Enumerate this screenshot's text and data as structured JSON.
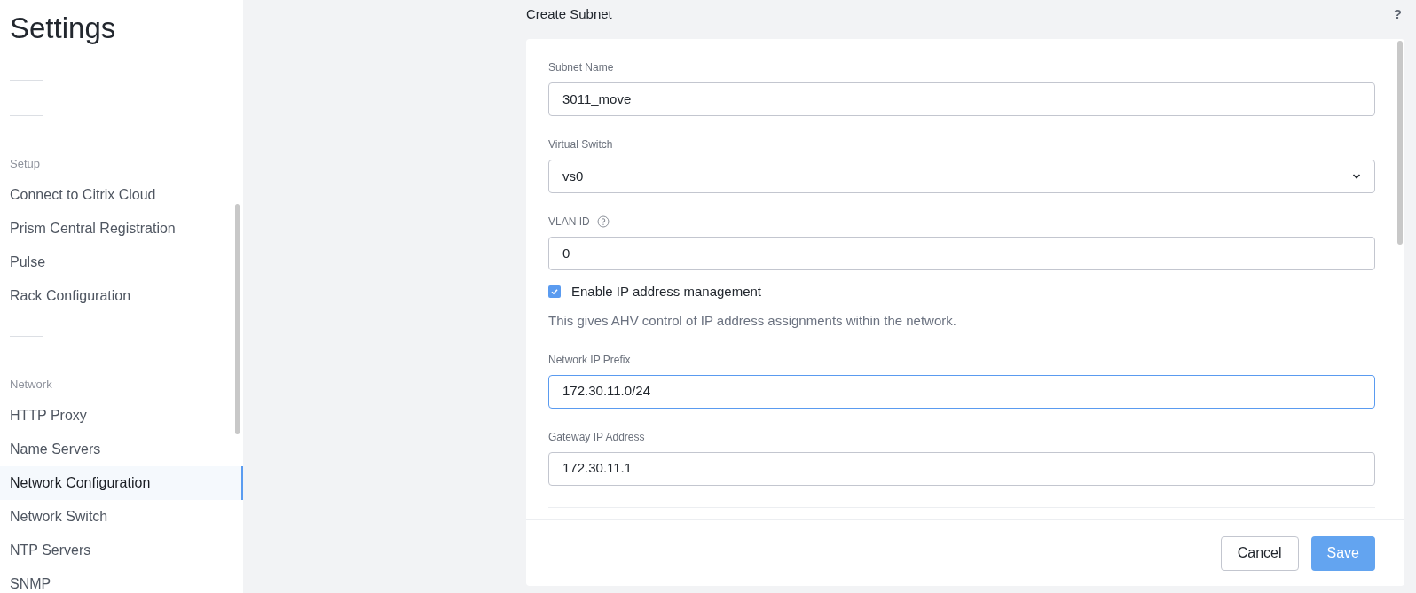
{
  "sidebar": {
    "title": "Settings",
    "sections": [
      {
        "heading": "Setup",
        "items": [
          {
            "label": "Connect to Citrix Cloud",
            "selected": false
          },
          {
            "label": "Prism Central Registration",
            "selected": false
          },
          {
            "label": "Pulse",
            "selected": false
          },
          {
            "label": "Rack Configuration",
            "selected": false
          }
        ]
      },
      {
        "heading": "Network",
        "items": [
          {
            "label": "HTTP Proxy",
            "selected": false
          },
          {
            "label": "Name Servers",
            "selected": false
          },
          {
            "label": "Network Configuration",
            "selected": true
          },
          {
            "label": "Network Switch",
            "selected": false
          },
          {
            "label": "NTP Servers",
            "selected": false
          },
          {
            "label": "SNMP",
            "selected": false
          }
        ]
      }
    ]
  },
  "dialog": {
    "title": "Create Subnet",
    "help": "?",
    "fields": [
      {
        "kind": "text",
        "label": "Subnet Name",
        "value": "3011_move",
        "focused": false
      },
      {
        "kind": "select",
        "label": "Virtual Switch",
        "value": "vs0",
        "focused": false
      },
      {
        "kind": "text",
        "label": "VLAN ID",
        "value": "0",
        "focused": false,
        "help_icon": true
      },
      {
        "kind": "checkbox",
        "label": "Enable IP address management",
        "checked": true,
        "description": "This gives AHV control of IP address assignments within the network."
      },
      {
        "kind": "text",
        "label": "Network IP Prefix",
        "value": "172.30.11.0/24",
        "focused": true
      },
      {
        "kind": "text",
        "label": "Gateway IP Address",
        "value": "172.30.11.1",
        "focused": false
      }
    ],
    "buttons": [
      {
        "label": "Cancel",
        "kind": "secondary"
      },
      {
        "label": "Save",
        "kind": "primary"
      }
    ]
  }
}
